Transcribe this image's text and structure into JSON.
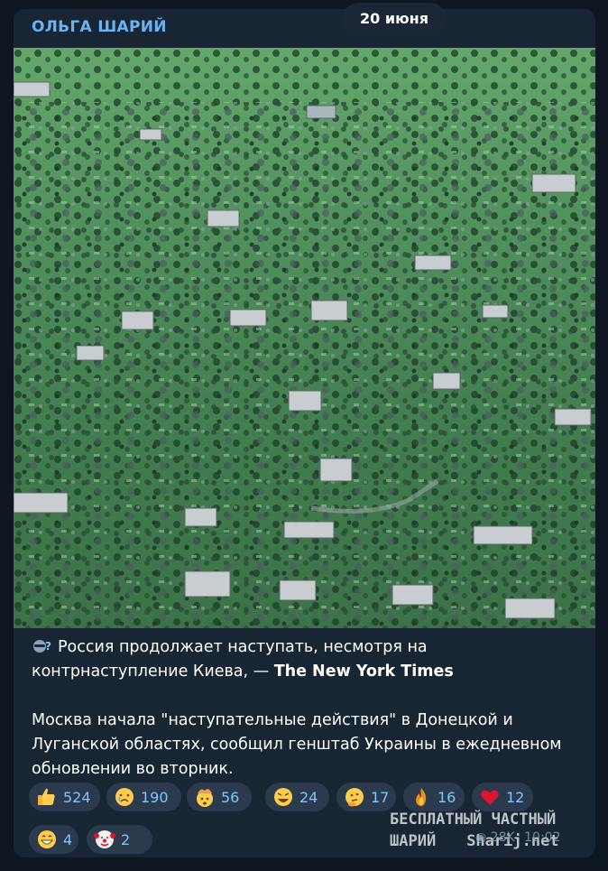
{
  "date": "20 июня",
  "post": {
    "channel": "ОЛЬГА ШАРИЙ",
    "image_icon": "destroyed-village-photo",
    "lead_emoji_icon": "anonymous-spy-icon",
    "lead_text": "Россия продолжает наступать, несмотря на контрнаступление Киева, —",
    "source": "The New York Times",
    "body": "Москва начала \"наступательные действия\" в Донецкой и Луганской областях, сообщил генштаб Украины в ежедневном обновлении во вторник.",
    "views": "28K",
    "time": "10:02"
  },
  "reactions": [
    {
      "icon": "thumbs-up-icon",
      "count": "524"
    },
    {
      "icon": "crying-face-icon",
      "count": "190"
    },
    {
      "icon": "exploding-head-icon",
      "count": "56"
    },
    {
      "icon": "rofl-face-icon",
      "count": "24"
    },
    {
      "icon": "thinking-face-icon",
      "count": "17"
    },
    {
      "icon": "fire-icon",
      "count": "16"
    },
    {
      "icon": "red-heart-icon",
      "count": "12"
    },
    {
      "icon": "grinning-face-icon",
      "count": "4"
    },
    {
      "icon": "clown-face-icon",
      "count": "2"
    }
  ],
  "watermark": {
    "line1": "БЕСПЛАТНЫЙ ЧАСТНЫЙ",
    "line2": "ШАРИЙ",
    "site": "Sharij.net"
  },
  "colors": {
    "background": "#0e1621",
    "bubble": "#182533",
    "accent": "#6ab3f3",
    "reaction_bg": "#2b3a4c"
  }
}
